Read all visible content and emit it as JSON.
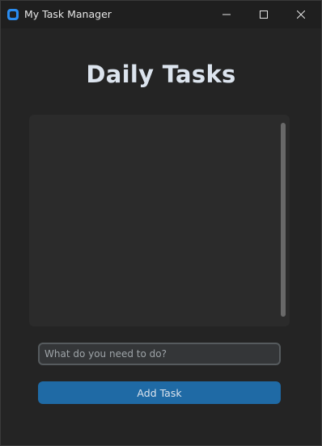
{
  "window": {
    "title": "My Task Manager",
    "icons": {
      "app": "app-icon",
      "minimize": "minimize-icon",
      "maximize": "maximize-icon",
      "close": "close-icon"
    }
  },
  "main": {
    "heading": "Daily Tasks",
    "task_list": {
      "items": []
    },
    "task_input": {
      "value": "",
      "placeholder": "What do you need to do?"
    },
    "add_button_label": "Add Task"
  },
  "colors": {
    "background": "#242424",
    "titlebar": "#1f1f1f",
    "panel": "#2b2b2b",
    "accent": "#1f6aa5",
    "heading_text": "#dce4ee",
    "app_icon": "#2a8cf0"
  }
}
